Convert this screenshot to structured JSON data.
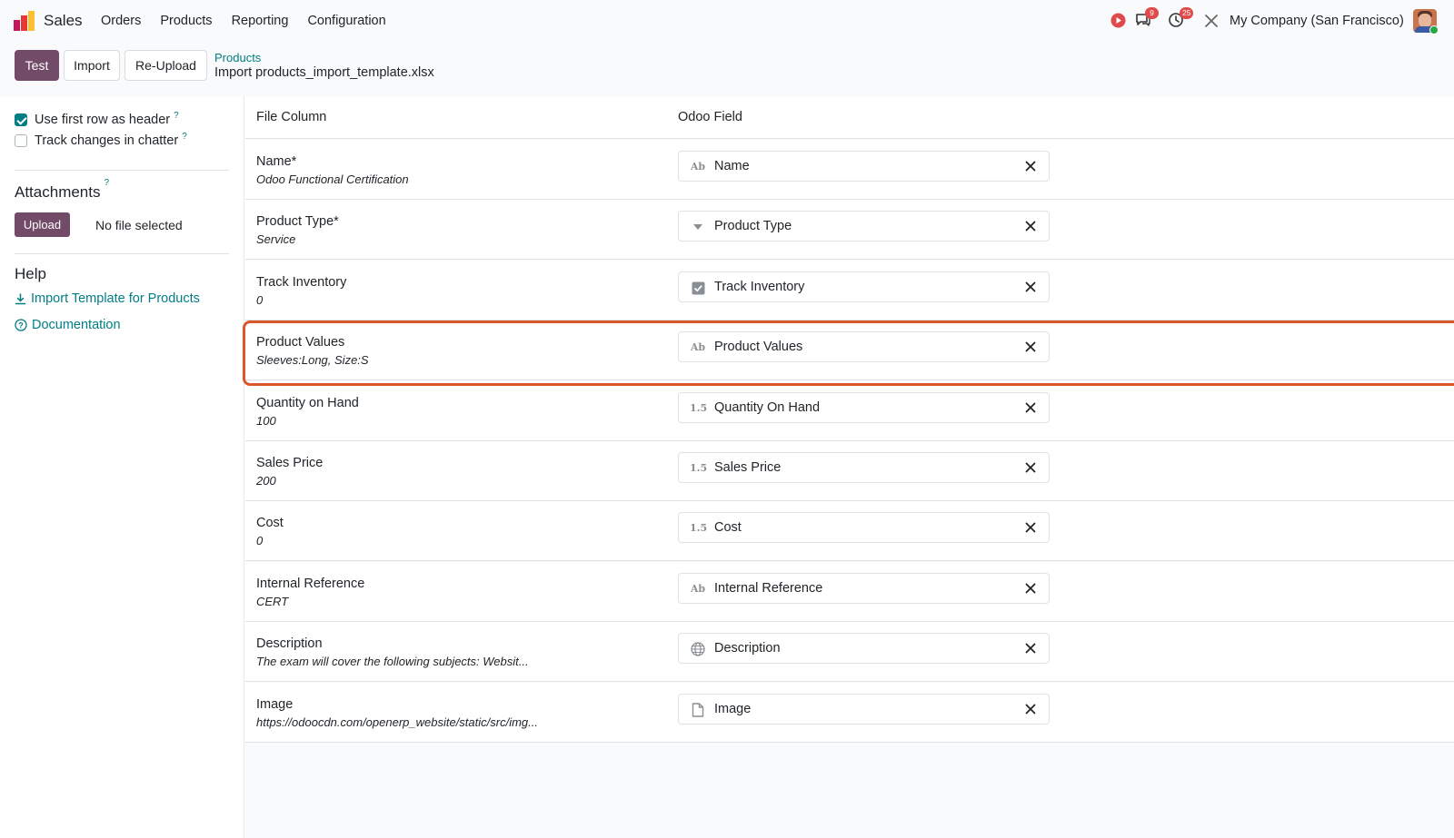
{
  "app": {
    "name": "Sales"
  },
  "menu": [
    "Orders",
    "Products",
    "Reporting",
    "Configuration"
  ],
  "systray": {
    "messages_count": "9",
    "activities_count": "25",
    "company": "My Company (San Francisco)"
  },
  "toolbar": {
    "test_label": "Test",
    "import_label": "Import",
    "reupload_label": "Re-Upload"
  },
  "breadcrumb": {
    "parent": "Products",
    "current": "Import products_import_template.xlsx"
  },
  "sidebar": {
    "options": [
      {
        "label": "Use first row as header",
        "checked": true
      },
      {
        "label": "Track changes in chatter",
        "checked": false
      }
    ],
    "help_marker": "?",
    "attachments_title": "Attachments",
    "upload_label": "Upload",
    "no_file": "No file selected",
    "help_title": "Help",
    "template_link": "Import Template for Products",
    "doc_link": "Documentation"
  },
  "table": {
    "headers": {
      "file_column": "File Column",
      "odoo_field": "Odoo Field"
    },
    "rows": [
      {
        "name": "Name*",
        "sample": "Odoo Functional Certification",
        "field": "Name",
        "icon": "text-icon"
      },
      {
        "name": "Product Type*",
        "sample": "Service",
        "field": "Product Type",
        "icon": "selection-icon"
      },
      {
        "name": "Track Inventory",
        "sample": "0",
        "field": "Track Inventory",
        "icon": "checkbox-icon"
      },
      {
        "name": "Product Values",
        "sample": "Sleeves:Long, Size:S",
        "field": "Product Values",
        "icon": "text-icon",
        "highlighted": true
      },
      {
        "name": "Quantity on Hand",
        "sample": "100",
        "field": "Quantity On Hand",
        "icon": "float-icon"
      },
      {
        "name": "Sales Price",
        "sample": "200",
        "field": "Sales Price",
        "icon": "float-icon"
      },
      {
        "name": "Cost",
        "sample": "0",
        "field": "Cost",
        "icon": "float-icon"
      },
      {
        "name": "Internal Reference",
        "sample": "CERT",
        "field": "Internal Reference",
        "icon": "text-icon"
      },
      {
        "name": "Description",
        "sample": "The exam will cover the following subjects: Websit...",
        "field": "Description",
        "icon": "globe-icon"
      },
      {
        "name": "Image",
        "sample": "https://odoocdn.com/openerp_website/static/src/img...",
        "field": "Image",
        "icon": "file-icon"
      }
    ]
  },
  "icon_glyphs": {
    "text-icon": "Ab",
    "float-icon": "1.5"
  },
  "colors": {
    "primary": "#714b67",
    "link": "#017e84",
    "highlight": "#d9582b"
  }
}
